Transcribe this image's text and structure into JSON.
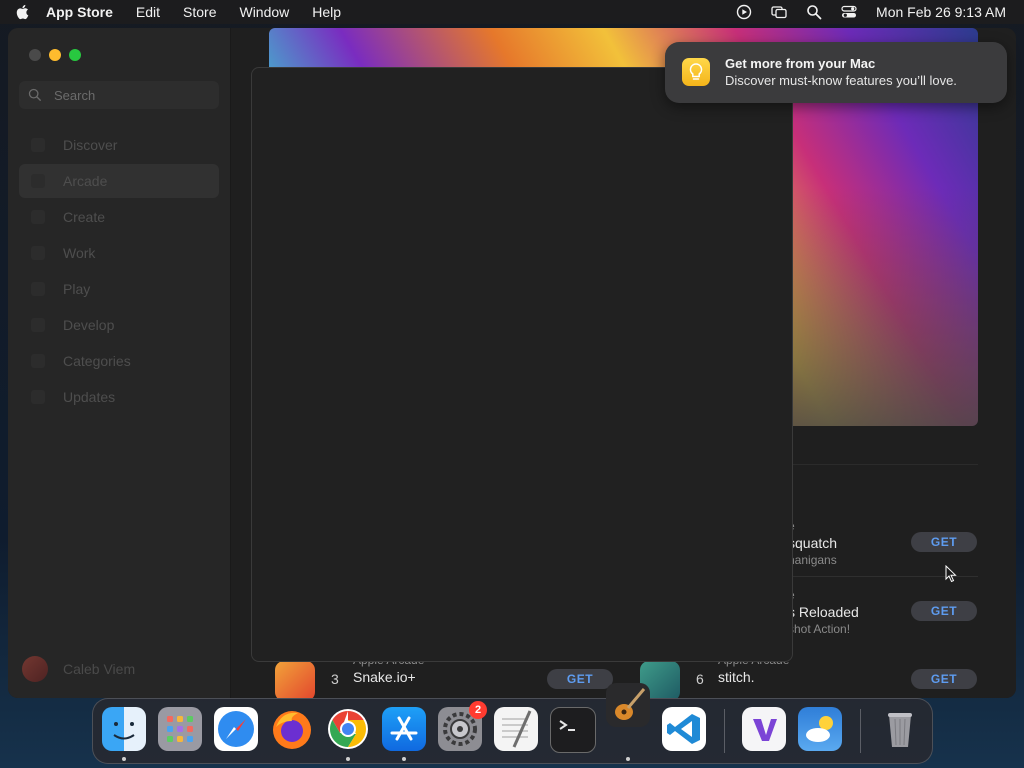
{
  "menubar": {
    "app_name": "App Store",
    "menus": [
      "Edit",
      "Store",
      "Window",
      "Help"
    ],
    "status_icons": [
      "screen-recording-icon",
      "screen-mirroring-icon",
      "spotlight-search-icon",
      "control-center-icon"
    ],
    "clock": "Mon Feb 26  9:13 AM"
  },
  "sidebar": {
    "search_placeholder": "Search",
    "items": [
      {
        "label": "Discover",
        "selected": false
      },
      {
        "label": "Arcade",
        "selected": true
      },
      {
        "label": "Create",
        "selected": false
      },
      {
        "label": "Work",
        "selected": false
      },
      {
        "label": "Play",
        "selected": false
      },
      {
        "label": "Develop",
        "selected": false
      },
      {
        "label": "Categories",
        "selected": false
      },
      {
        "label": "Updates",
        "selected": false
      }
    ],
    "profile_name": "Caleb Viem"
  },
  "content": {
    "apps": [
      {
        "category": "e",
        "title": "squatch",
        "subtitle": "nanigans",
        "button": "GET"
      },
      {
        "category": "e",
        "title": "s Reloaded",
        "subtitle": "shot Action!",
        "button": "GET"
      },
      {
        "rank": "3",
        "category": "Apple Arcade",
        "title": "Snake.io+",
        "subtitle": "",
        "button": "GET"
      },
      {
        "rank": "6",
        "category": "Apple Arcade",
        "title": "stitch.",
        "subtitle": "",
        "button": "GET"
      }
    ]
  },
  "notification": {
    "title": "Get more from your Mac",
    "body": "Discover must-know features you’ll love."
  },
  "dock": {
    "apps": [
      "Finder",
      "Launchpad",
      "Safari",
      "Firefox",
      "Chrome",
      "App Store",
      "System Settings",
      "TextEdit",
      "Terminal",
      "GarageBand",
      "Visual Studio Code",
      "Visual Studio",
      "Weather",
      "Trash"
    ],
    "settings_badge": "2"
  }
}
